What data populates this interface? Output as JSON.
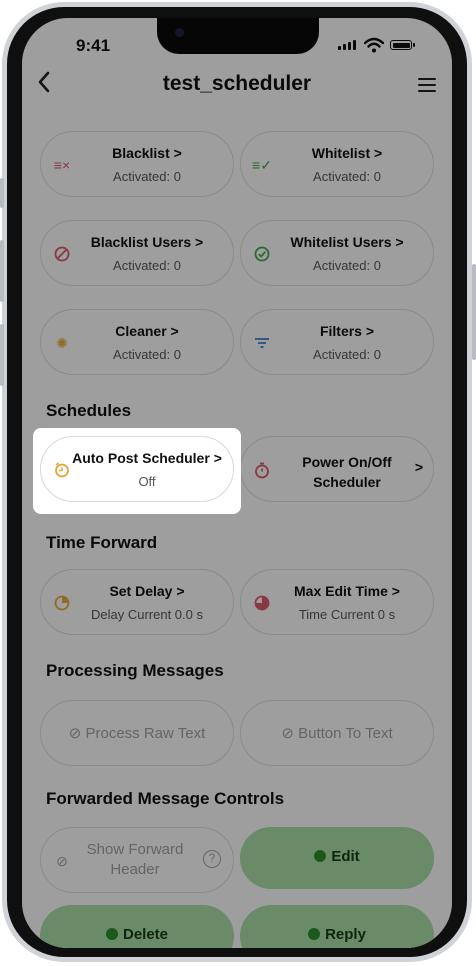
{
  "status": {
    "time": "9:41"
  },
  "appbar": {
    "title": "test_scheduler",
    "back_icon": "chevron-left-icon",
    "menu_icon": "hamburger-menu-icon"
  },
  "cards": {
    "blacklist": {
      "label": "Blacklist",
      "sub": "Activated: 0",
      "icon": "blacklist-icon",
      "icon_color": "#d6576a"
    },
    "whitelist": {
      "label": "Whitelist",
      "sub": "Activated: 0",
      "icon": "whitelist-icon",
      "icon_color": "#43a447"
    },
    "blacklist_users": {
      "label": "Blacklist Users",
      "sub": "Activated: 0",
      "icon": "block-icon",
      "icon_color": "#d6576a"
    },
    "whitelist_users": {
      "label": "Whitelist Users",
      "sub": "Activated: 0",
      "icon": "check-circle-icon",
      "icon_color": "#43a447"
    },
    "cleaner": {
      "label": "Cleaner",
      "sub": "Activated: 0",
      "icon": "sparkle-icon",
      "icon_color": "#e3a63a"
    },
    "filters": {
      "label": "Filters",
      "sub": "Activated: 0",
      "icon": "filter-icon",
      "icon_color": "#3d7fd6"
    }
  },
  "sections": {
    "schedules": "Schedules",
    "time_forward": "Time Forward",
    "processing": "Processing Messages",
    "forwarded": "Forwarded Message Controls"
  },
  "schedules": {
    "auto_post": {
      "label": "Auto Post Scheduler",
      "sub": "Off",
      "icon": "clock-icon",
      "icon_color": "#e3a63a"
    },
    "power": {
      "line1": "Power On/Off",
      "line2": "Scheduler",
      "icon": "timer-icon",
      "icon_color": "#d6576a"
    }
  },
  "time_forward": {
    "set_delay": {
      "label": "Set Delay",
      "sub": "Delay Current 0.0 s",
      "icon": "delay-icon",
      "icon_color": "#e3a63a"
    },
    "max_edit": {
      "label": "Max Edit Time",
      "sub": "Time Current 0 s",
      "icon": "edit-time-icon",
      "icon_color": "#d6576a"
    }
  },
  "processing": {
    "raw_text": "Process Raw Text",
    "button_text": "Button To Text"
  },
  "forwarded": {
    "show_header_line1": "Show Forward",
    "show_header_line2": "Header",
    "edit": "Edit",
    "delete": "Delete",
    "reply": "Reply"
  },
  "chevron": ">"
}
